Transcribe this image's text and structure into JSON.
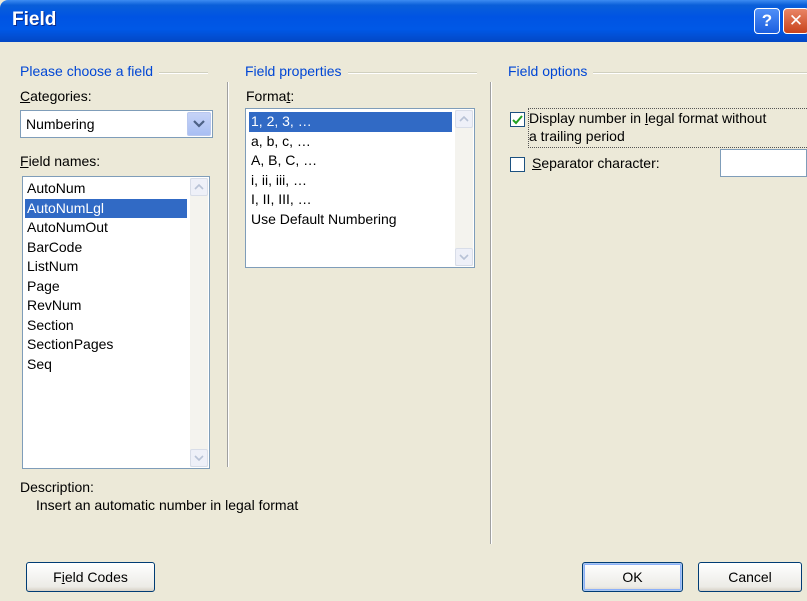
{
  "window": {
    "title": "Field"
  },
  "titlebar": {
    "help_glyph": "?",
    "close_glyph": "✕"
  },
  "choose": {
    "heading": "Please choose a field",
    "categories_label": {
      "pre": "",
      "key": "C",
      "post": "ategories:"
    },
    "category_value": "Numbering",
    "field_names_label": {
      "pre": "",
      "key": "F",
      "post": "ield names:"
    },
    "field_names": [
      "AutoNum",
      "AutoNumLgl",
      "AutoNumOut",
      "BarCode",
      "ListNum",
      "Page",
      "RevNum",
      "Section",
      "SectionPages",
      "Seq"
    ],
    "selected_field": "AutoNumLgl"
  },
  "properties": {
    "heading": "Field properties",
    "format_label": {
      "pre": "Forma",
      "key": "t",
      "post": ":"
    },
    "formats": [
      "1, 2, 3, …",
      "a, b, c, …",
      "A, B, C, …",
      "i, ii, iii, …",
      "I, II, III, …",
      "Use Default Numbering"
    ],
    "selected_format": "1, 2, 3, …"
  },
  "options": {
    "heading": "Field options",
    "legal_format": {
      "line1": {
        "pre": "Display number in ",
        "key": "l",
        "post": "egal format without"
      },
      "line2": "a trailing period",
      "checked": true
    },
    "separator": {
      "label": {
        "pre": "",
        "key": "S",
        "post": "eparator character:"
      },
      "checked": false,
      "value": ""
    }
  },
  "description": {
    "label": "Description:",
    "text": "Insert an automatic number in legal format"
  },
  "buttons": {
    "field_codes": {
      "pre": "F",
      "key": "i",
      "post": "eld Codes"
    },
    "ok": "OK",
    "cancel": "Cancel"
  },
  "colors": {
    "accent_heading": "#0046d5",
    "selection": "#316ac5",
    "titlebar": "#0054e3"
  }
}
